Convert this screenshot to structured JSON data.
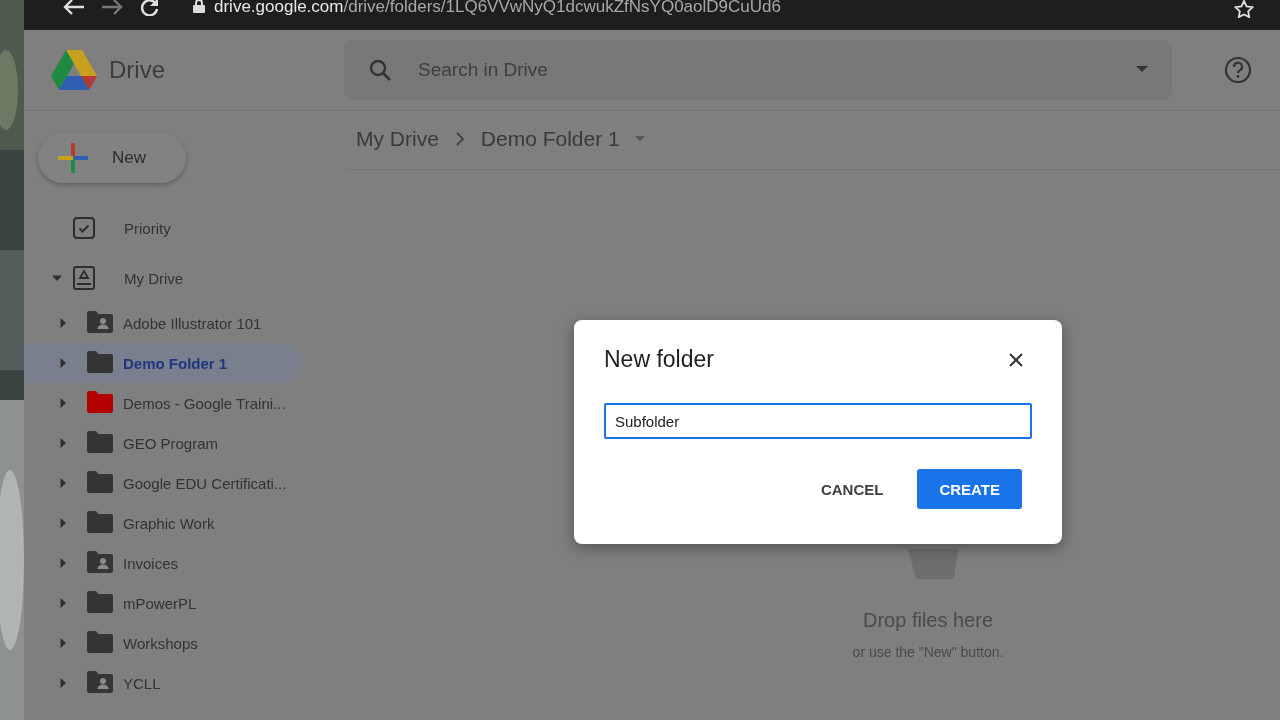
{
  "browser": {
    "url_host": "drive.google.com",
    "url_path": "/drive/folders/1LQ6VVwNyQ1dcwukZfNsYQ0aolD9CuUd6"
  },
  "header": {
    "app_name": "Drive",
    "search": {
      "placeholder": "Search in Drive"
    }
  },
  "sidebar": {
    "new_button": "New",
    "items": [
      {
        "kind": "priority",
        "label": "Priority",
        "selected": false
      },
      {
        "kind": "drive",
        "label": "My Drive",
        "selected": false,
        "expanded": true,
        "children": [
          {
            "kind": "shared",
            "label": "Adobe Illustrator 101",
            "color": "#353535",
            "selected": false
          },
          {
            "kind": "folder",
            "label": "Demo Folder 1",
            "color": "#353535",
            "selected": true
          },
          {
            "kind": "folder",
            "label": "Demos - Google Traini...",
            "color": "#b40000",
            "selected": false
          },
          {
            "kind": "folder",
            "label": "GEO Program",
            "color": "#353535",
            "selected": false
          },
          {
            "kind": "folder",
            "label": "Google EDU Certificati...",
            "color": "#353535",
            "selected": false
          },
          {
            "kind": "folder",
            "label": "Graphic Work",
            "color": "#353535",
            "selected": false
          },
          {
            "kind": "shared",
            "label": "Invoices",
            "color": "#353535",
            "selected": false
          },
          {
            "kind": "folder",
            "label": "mPowerPL",
            "color": "#353535",
            "selected": false
          },
          {
            "kind": "folder",
            "label": "Workshops",
            "color": "#353535",
            "selected": false
          },
          {
            "kind": "shared",
            "label": "YCLL",
            "color": "#353535",
            "selected": false
          }
        ]
      }
    ]
  },
  "breadcrumb": [
    "My Drive",
    "Demo Folder 1"
  ],
  "empty_state": {
    "title": "Drop files here",
    "hint": "or use the \"New\" button."
  },
  "dialog": {
    "title": "New folder",
    "value": "Subfolder",
    "buttons": [
      {
        "kind": "text",
        "label": "CANCEL"
      },
      {
        "kind": "primary",
        "label": "CREATE"
      }
    ]
  }
}
